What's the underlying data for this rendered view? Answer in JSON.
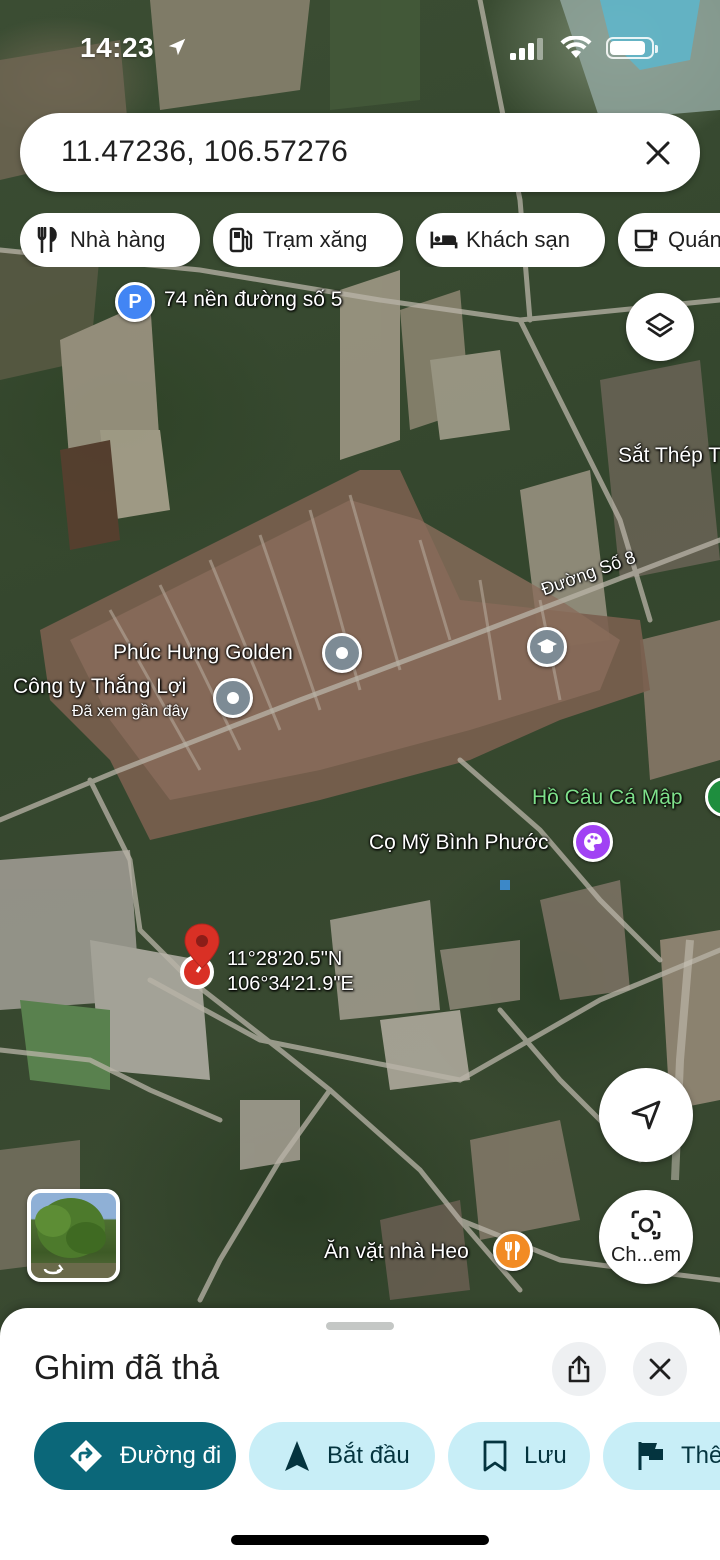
{
  "status_bar": {
    "time": "14:23"
  },
  "search": {
    "query": "11.47236, 106.57276"
  },
  "chips": [
    {
      "label": "Nhà hàng",
      "icon": "restaurant-icon"
    },
    {
      "label": "Trạm xăng",
      "icon": "gas-station-icon"
    },
    {
      "label": "Khách sạn",
      "icon": "hotel-icon"
    },
    {
      "label": "Quán",
      "icon": "cafe-icon"
    }
  ],
  "map": {
    "labels": {
      "parking_place": "74 nền đường số 5",
      "steel_company": "Sắt Thép T",
      "road": "Đường Số 8",
      "phuc_hung": "Phúc Hưng Golden",
      "thang_loi": "Công ty Thắng Lợi",
      "thang_loi_sub": "Đã xem gần đây",
      "ho_cau": "Hồ Câu Cá Mập",
      "co_my": "Cọ Mỹ Bình Phước",
      "an_vat": "Ăn vặt nhà Heo"
    },
    "pin": {
      "lat_dms": "11°28'20.5\"N",
      "lng_dms": "106°34'21.9\"E"
    },
    "lens_label": "Ch...em"
  },
  "colors": {
    "primary_action": "#0b6779",
    "secondary_action": "#c8eef7",
    "pin_red": "#d93025",
    "parking_blue": "#4285f4",
    "food_orange": "#f28b24",
    "art_purple": "#a142f4",
    "place_gray": "#7d8b95"
  },
  "sheet": {
    "title": "Ghim đã thả",
    "actions": [
      {
        "label": "Đường đi",
        "icon": "directions-icon"
      },
      {
        "label": "Bắt đầu",
        "icon": "navigation-arrow-icon"
      },
      {
        "label": "Lưu",
        "icon": "bookmark-icon"
      },
      {
        "label": "Thê",
        "icon": "flag-icon"
      }
    ]
  }
}
